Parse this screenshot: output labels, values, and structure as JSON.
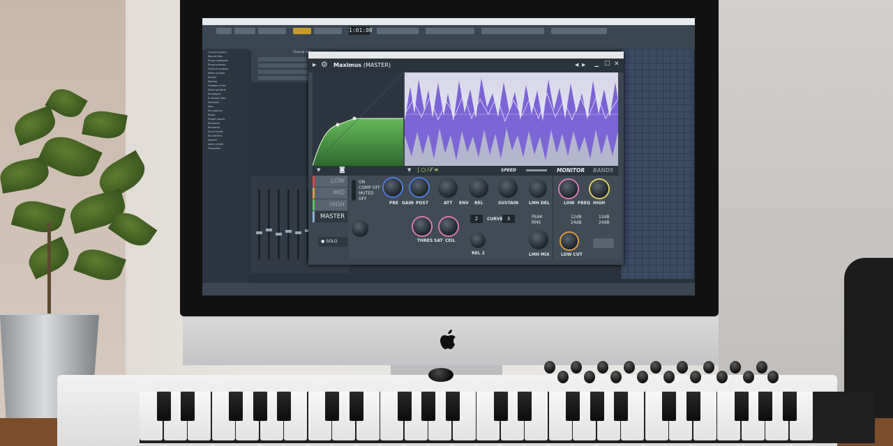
{
  "plugin": {
    "title": "Maximus",
    "title_suffix": "(MASTER)",
    "win_back": "◀",
    "win_fwd": "▶",
    "win_min": "▁",
    "win_max": "□",
    "win_close": "✕",
    "speed_label": "SPEED",
    "tab_monitor": "MONITOR",
    "tab_bands": "BANDS",
    "bands": [
      "LOW",
      "MID",
      "HIGH",
      "MASTER"
    ],
    "mode_options": [
      "ON",
      "COMP OFF",
      "MUTED",
      "OFF"
    ],
    "solo": "SOLO",
    "labels": {
      "pre": "PRE",
      "gain": "GAIN",
      "post": "POST",
      "att": "ATT",
      "env": "ENV",
      "rel": "REL",
      "sustain": "SUSTAIN",
      "thres": "THRES",
      "sat": "SAT",
      "ceil": "CEIL",
      "curve": "CURVE",
      "rel2": "REL 2",
      "peak": "PEAK",
      "rms": "RMS",
      "lmh_del": "LMH DEL",
      "lmh_mix": "LMH MIX",
      "low": "LOW",
      "freq": "FREQ",
      "high": "HIGH",
      "low_cut": "LOW CUT"
    },
    "stepper_left": "2",
    "stepper_curve": "3",
    "slope_low": [
      "12dB",
      "24dB"
    ],
    "slope_high": [
      "12dB",
      "24dB"
    ]
  },
  "daw": {
    "time": "1:01:00",
    "browser_items": [
      "Current project",
      "Recent files",
      "Plugin database",
      "Plugin presets",
      "Channel presets",
      "Mixer presets",
      "Scores",
      "Backup",
      "Clipboard files",
      "Demo projects",
      "Envelopes",
      "IL shared data",
      "Impulses",
      "Misc",
      "My projects",
      "Packs",
      "Project bones",
      "Recorded",
      "Rendered",
      "Sliced audio",
      "Soundfonts",
      "Speech",
      "splice_folder",
      "Templates"
    ],
    "channel_rack_title": "Channel rack"
  },
  "colors": {
    "accent_purple": "#7a5de0",
    "accent_green": "#4fa64a",
    "knob_ring_blue": "#4f7be0",
    "knob_ring_pink": "#e07ab0",
    "knob_ring_orange": "#e0a040"
  }
}
